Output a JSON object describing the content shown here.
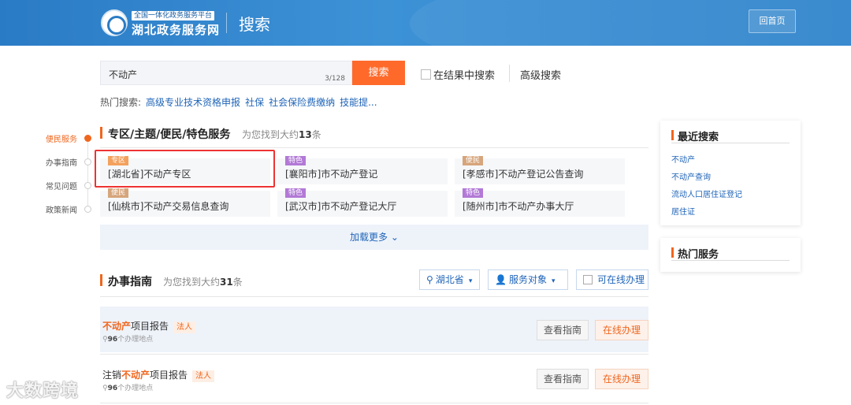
{
  "header": {
    "logo_small": "全国一体化政务服务平台",
    "logo_big": "湖北政务服务网",
    "title": "搜索",
    "home_button": "回首页"
  },
  "search": {
    "value": "不动产",
    "count": "3/128",
    "button": "搜索",
    "within_results": "在结果中搜索",
    "advanced": "高级搜索",
    "hot_label": "热门搜索:",
    "hot_links": [
      "高级专业技术资格申报",
      "社保",
      "社会保险费缴纳",
      "技能提..."
    ]
  },
  "leftnav": {
    "items": [
      "便民服务",
      "办事指南",
      "常见问题",
      "政策新闻"
    ]
  },
  "section1": {
    "title": "专区/主题/便民/特色服务",
    "sub_prefix": "为您找到大约",
    "count": "13",
    "sub_suffix": "条",
    "cards": [
      {
        "tag": "专区",
        "text": "[湖北省]不动产专区"
      },
      {
        "tag": "特色",
        "text": "[襄阳市]市不动产登记"
      },
      {
        "tag": "便民",
        "text": "[孝感市]不动产登记公告查询"
      },
      {
        "tag": "便民",
        "text": "[仙桃市]不动产交易信息查询"
      },
      {
        "tag": "特色",
        "text": "[武汉市]市不动产登记大厅"
      },
      {
        "tag": "特色",
        "text": "[随州市]市不动产办事大厅"
      }
    ],
    "load_more": "加载更多",
    "chevron_icon": "chevron-down-icon"
  },
  "section2": {
    "title": "办事指南",
    "sub_prefix": "为您找到大约",
    "count": "31",
    "sub_suffix": "条",
    "filters": {
      "region": "湖北省",
      "target": "服务对象",
      "online": "可在线办理"
    },
    "rows": [
      {
        "pre": "",
        "hl": "不动产",
        "post": "项目报告",
        "tag": "法人",
        "count": "96",
        "count_suffix": "个办理地点",
        "guide": "查看指南",
        "online": "在线办理"
      },
      {
        "pre": "注销",
        "hl": "不动产",
        "post": "项目报告",
        "tag": "法人",
        "count": "96",
        "count_suffix": "个办理地点",
        "guide": "查看指南",
        "online": "在线办理"
      }
    ]
  },
  "recent": {
    "title": "最近搜索",
    "links": [
      "不动产",
      "不动产查询",
      "流动人口居住证登记",
      "居住证"
    ]
  },
  "hot_services": {
    "title": "热门服务"
  },
  "watermark": "大数跨境",
  "colors": {
    "accent": "#f0661e",
    "link": "#1f64b8",
    "header": "#2a7bc5"
  }
}
